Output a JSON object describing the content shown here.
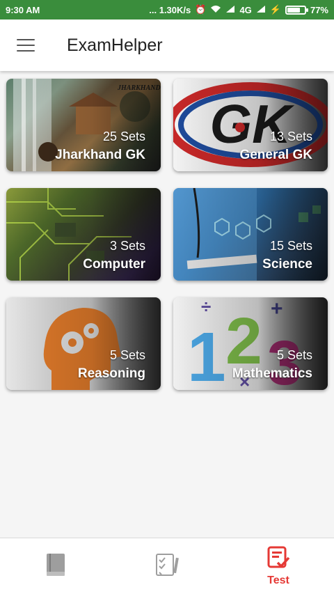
{
  "status_bar": {
    "time": "9:30 AM",
    "net_speed": "... 1.30K/s",
    "network": "4G",
    "battery": "77%",
    "battery_level": 0.77
  },
  "app_bar": {
    "title": "ExamHelper",
    "menu_icon": "hamburger-menu-icon"
  },
  "categories": [
    {
      "sets": "25 Sets",
      "name": "Jharkhand GK",
      "image_text": "JHARKHAND"
    },
    {
      "sets": "13 Sets",
      "name": "General GK",
      "image_text": "GK"
    },
    {
      "sets": "3 Sets",
      "name": "Computer"
    },
    {
      "sets": "15 Sets",
      "name": "Science"
    },
    {
      "sets": "5 Sets",
      "name": "Reasoning"
    },
    {
      "sets": "5 Sets",
      "name": "Mathematics",
      "image_text": "123"
    }
  ],
  "bottom_nav": {
    "items": [
      {
        "icon": "book-icon",
        "label": ""
      },
      {
        "icon": "checklist-icon",
        "label": ""
      },
      {
        "icon": "test-icon",
        "label": "Test",
        "active": true
      }
    ],
    "active_color": "#e53935",
    "inactive_color": "#9e9e9e"
  },
  "colors": {
    "status_bar": "#3a8d3c",
    "accent": "#e53935"
  }
}
